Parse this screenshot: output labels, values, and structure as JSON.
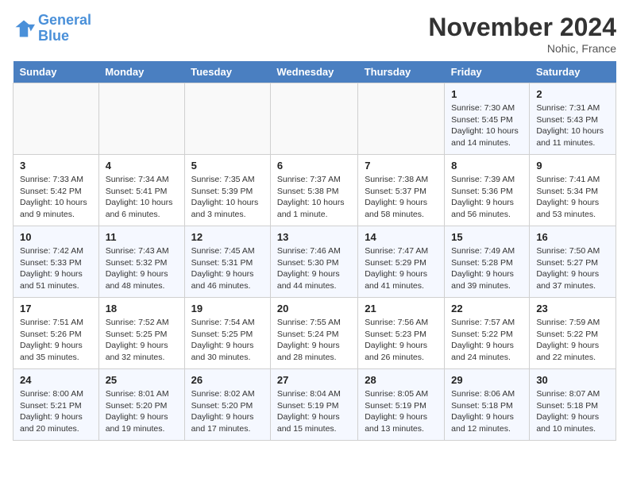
{
  "header": {
    "logo_line1": "General",
    "logo_line2": "Blue",
    "month": "November 2024",
    "location": "Nohic, France"
  },
  "weekdays": [
    "Sunday",
    "Monday",
    "Tuesday",
    "Wednesday",
    "Thursday",
    "Friday",
    "Saturday"
  ],
  "weeks": [
    [
      {
        "day": "",
        "info": ""
      },
      {
        "day": "",
        "info": ""
      },
      {
        "day": "",
        "info": ""
      },
      {
        "day": "",
        "info": ""
      },
      {
        "day": "",
        "info": ""
      },
      {
        "day": "1",
        "info": "Sunrise: 7:30 AM\nSunset: 5:45 PM\nDaylight: 10 hours and 14 minutes."
      },
      {
        "day": "2",
        "info": "Sunrise: 7:31 AM\nSunset: 5:43 PM\nDaylight: 10 hours and 11 minutes."
      }
    ],
    [
      {
        "day": "3",
        "info": "Sunrise: 7:33 AM\nSunset: 5:42 PM\nDaylight: 10 hours and 9 minutes."
      },
      {
        "day": "4",
        "info": "Sunrise: 7:34 AM\nSunset: 5:41 PM\nDaylight: 10 hours and 6 minutes."
      },
      {
        "day": "5",
        "info": "Sunrise: 7:35 AM\nSunset: 5:39 PM\nDaylight: 10 hours and 3 minutes."
      },
      {
        "day": "6",
        "info": "Sunrise: 7:37 AM\nSunset: 5:38 PM\nDaylight: 10 hours and 1 minute."
      },
      {
        "day": "7",
        "info": "Sunrise: 7:38 AM\nSunset: 5:37 PM\nDaylight: 9 hours and 58 minutes."
      },
      {
        "day": "8",
        "info": "Sunrise: 7:39 AM\nSunset: 5:36 PM\nDaylight: 9 hours and 56 minutes."
      },
      {
        "day": "9",
        "info": "Sunrise: 7:41 AM\nSunset: 5:34 PM\nDaylight: 9 hours and 53 minutes."
      }
    ],
    [
      {
        "day": "10",
        "info": "Sunrise: 7:42 AM\nSunset: 5:33 PM\nDaylight: 9 hours and 51 minutes."
      },
      {
        "day": "11",
        "info": "Sunrise: 7:43 AM\nSunset: 5:32 PM\nDaylight: 9 hours and 48 minutes."
      },
      {
        "day": "12",
        "info": "Sunrise: 7:45 AM\nSunset: 5:31 PM\nDaylight: 9 hours and 46 minutes."
      },
      {
        "day": "13",
        "info": "Sunrise: 7:46 AM\nSunset: 5:30 PM\nDaylight: 9 hours and 44 minutes."
      },
      {
        "day": "14",
        "info": "Sunrise: 7:47 AM\nSunset: 5:29 PM\nDaylight: 9 hours and 41 minutes."
      },
      {
        "day": "15",
        "info": "Sunrise: 7:49 AM\nSunset: 5:28 PM\nDaylight: 9 hours and 39 minutes."
      },
      {
        "day": "16",
        "info": "Sunrise: 7:50 AM\nSunset: 5:27 PM\nDaylight: 9 hours and 37 minutes."
      }
    ],
    [
      {
        "day": "17",
        "info": "Sunrise: 7:51 AM\nSunset: 5:26 PM\nDaylight: 9 hours and 35 minutes."
      },
      {
        "day": "18",
        "info": "Sunrise: 7:52 AM\nSunset: 5:25 PM\nDaylight: 9 hours and 32 minutes."
      },
      {
        "day": "19",
        "info": "Sunrise: 7:54 AM\nSunset: 5:25 PM\nDaylight: 9 hours and 30 minutes."
      },
      {
        "day": "20",
        "info": "Sunrise: 7:55 AM\nSunset: 5:24 PM\nDaylight: 9 hours and 28 minutes."
      },
      {
        "day": "21",
        "info": "Sunrise: 7:56 AM\nSunset: 5:23 PM\nDaylight: 9 hours and 26 minutes."
      },
      {
        "day": "22",
        "info": "Sunrise: 7:57 AM\nSunset: 5:22 PM\nDaylight: 9 hours and 24 minutes."
      },
      {
        "day": "23",
        "info": "Sunrise: 7:59 AM\nSunset: 5:22 PM\nDaylight: 9 hours and 22 minutes."
      }
    ],
    [
      {
        "day": "24",
        "info": "Sunrise: 8:00 AM\nSunset: 5:21 PM\nDaylight: 9 hours and 20 minutes."
      },
      {
        "day": "25",
        "info": "Sunrise: 8:01 AM\nSunset: 5:20 PM\nDaylight: 9 hours and 19 minutes."
      },
      {
        "day": "26",
        "info": "Sunrise: 8:02 AM\nSunset: 5:20 PM\nDaylight: 9 hours and 17 minutes."
      },
      {
        "day": "27",
        "info": "Sunrise: 8:04 AM\nSunset: 5:19 PM\nDaylight: 9 hours and 15 minutes."
      },
      {
        "day": "28",
        "info": "Sunrise: 8:05 AM\nSunset: 5:19 PM\nDaylight: 9 hours and 13 minutes."
      },
      {
        "day": "29",
        "info": "Sunrise: 8:06 AM\nSunset: 5:18 PM\nDaylight: 9 hours and 12 minutes."
      },
      {
        "day": "30",
        "info": "Sunrise: 8:07 AM\nSunset: 5:18 PM\nDaylight: 9 hours and 10 minutes."
      }
    ]
  ]
}
